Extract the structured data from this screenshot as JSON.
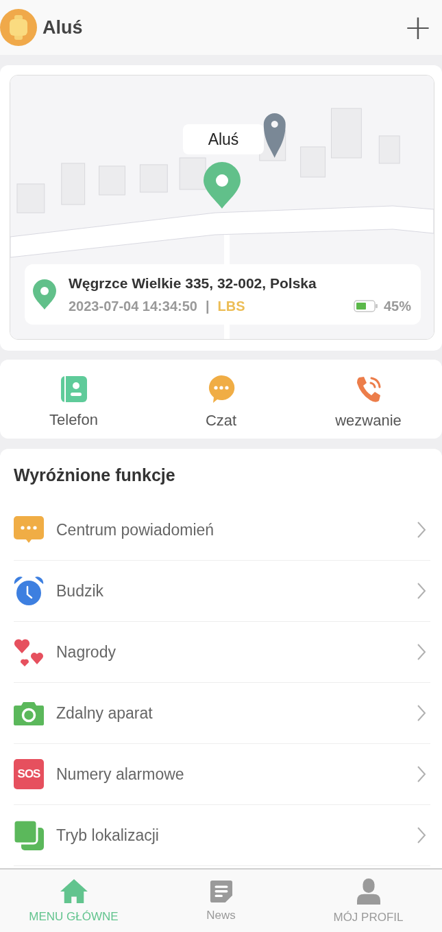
{
  "header": {
    "title": "Aluś",
    "add_button": "+"
  },
  "map": {
    "kind": "picture",
    "marker_label": "Aluś",
    "location": {
      "address": "Węgrzce Wielkie 335, 32-002, Polska",
      "time": "2023-07-04 14:34:50",
      "separator": "|",
      "source": "LBS",
      "battery": "45%"
    }
  },
  "actions": [
    {
      "kind": "contacts",
      "label": "Telefon"
    },
    {
      "kind": "chat",
      "label": "Czat"
    },
    {
      "kind": "call",
      "label": "wezwanie"
    }
  ],
  "features": {
    "title": "Wyróżnione funkcje",
    "items": [
      {
        "kind": "notify",
        "label": "Centrum powiadomień"
      },
      {
        "kind": "alarm",
        "label": "Budzik"
      },
      {
        "kind": "hearts",
        "label": "Nagrody"
      },
      {
        "kind": "camera",
        "label": "Zdalny aparat"
      },
      {
        "kind": "sos",
        "label": "Numery alarmowe",
        "badge": "SOS"
      },
      {
        "kind": "mode",
        "label": "Tryb lokalizacji"
      }
    ]
  },
  "tabs": [
    {
      "kind": "home",
      "label": "MENU GŁÓWNE",
      "selected": true
    },
    {
      "kind": "news",
      "label": "News",
      "selected": false
    },
    {
      "kind": "profile",
      "label": "MÓJ PROFIL",
      "selected": false
    }
  ]
}
